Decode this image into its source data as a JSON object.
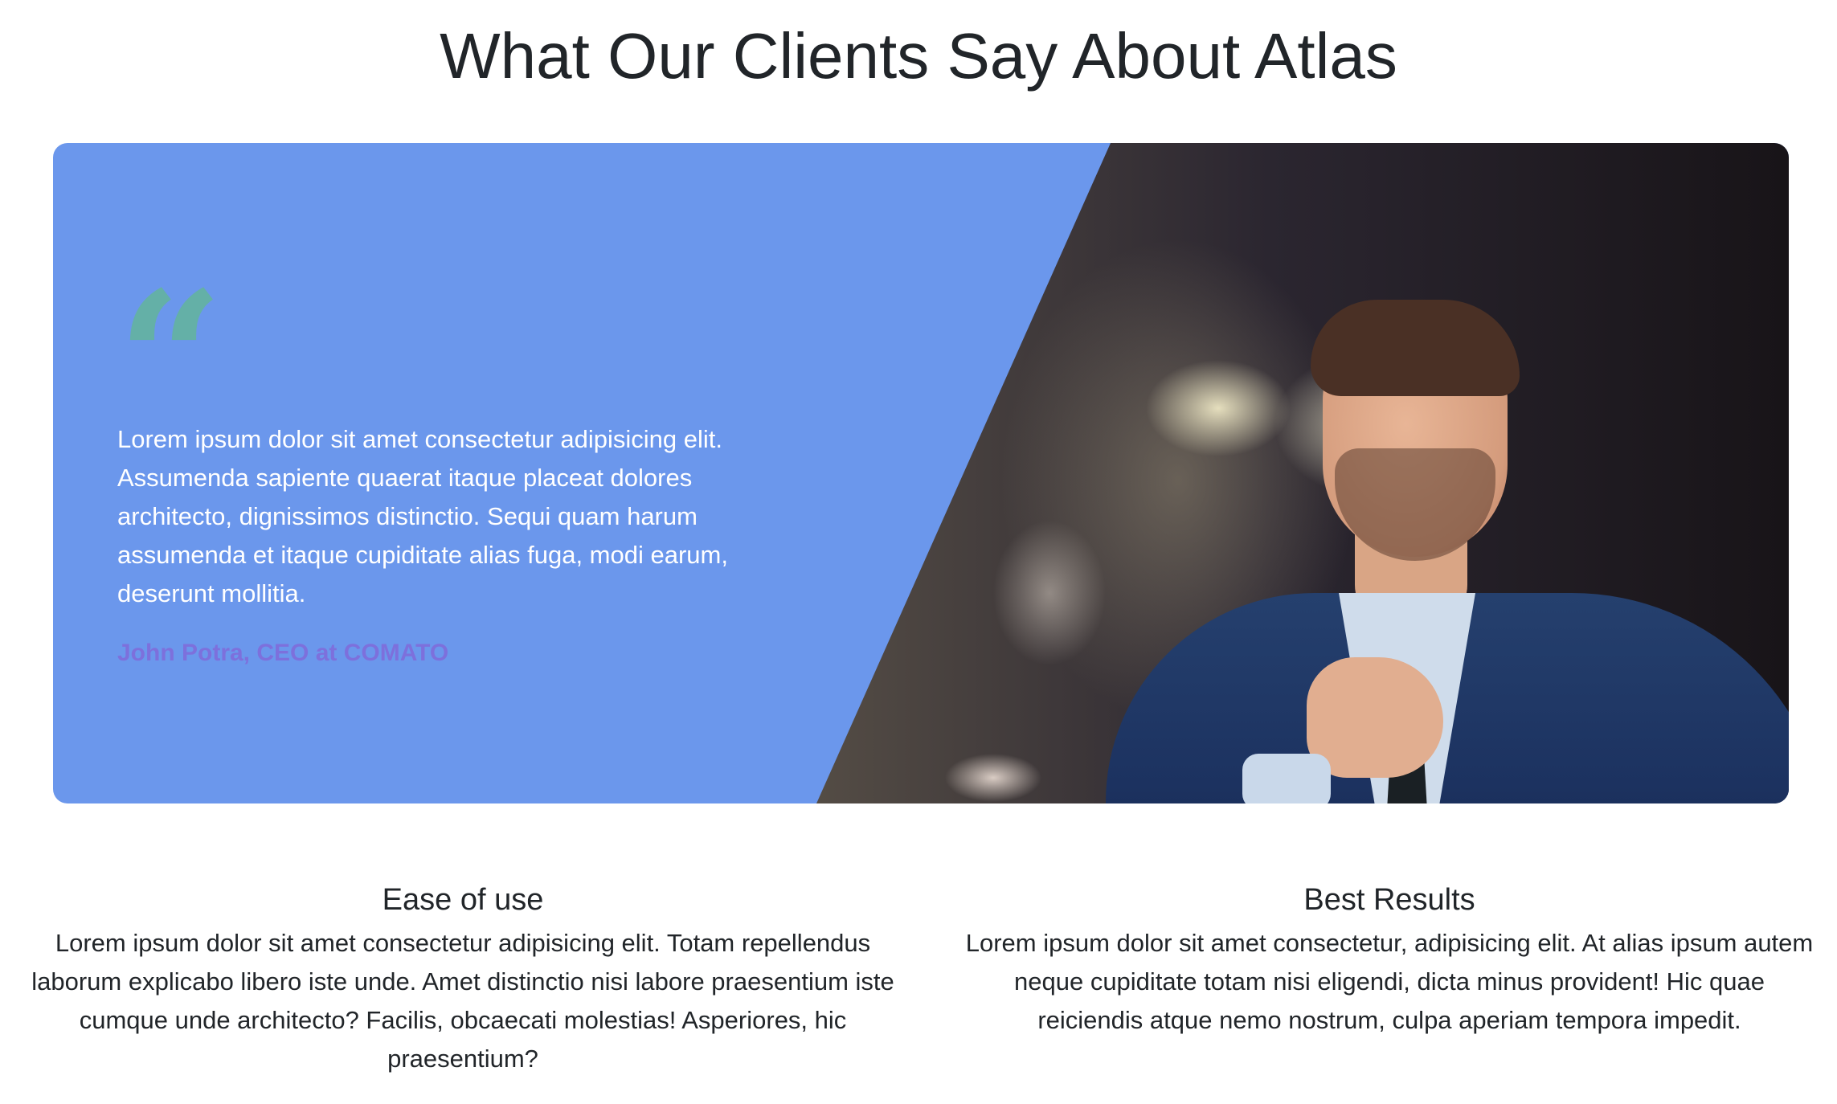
{
  "header": {
    "title": "What Our Clients Say About Atlas"
  },
  "testimonial": {
    "quote_glyph": "“",
    "text": "Lorem ipsum dolor sit amet consectetur adipisicing elit. Assumenda sapiente quaerat itaque placeat dolores architecto, dignissimos distinctio. Sequi quam harum assumenda et itaque cupiditate alias fuga, modi earum, deserunt mollitia.",
    "author": "John Potra, CEO at COMATO",
    "colors": {
      "panel": "#6b97ec",
      "quote_mark": "#64b0a7",
      "author": "#7d70dc"
    }
  },
  "features": [
    {
      "title": "Ease of use",
      "text": "Lorem ipsum dolor sit amet consectetur adipisicing elit. Totam repellendus laborum explicabo libero iste unde. Amet distinctio nisi labore praesentium iste cumque unde architecto? Facilis, obcaecati molestias! Asperiores, hic praesentium?"
    },
    {
      "title": "Best Results",
      "text": "Lorem ipsum dolor sit amet consectetur, adipisicing elit. At alias ipsum autem neque cupiditate totam nisi eligendi, dicta minus provident! Hic quae reiciendis atque nemo nostrum, culpa aperiam tempora impedit."
    }
  ]
}
